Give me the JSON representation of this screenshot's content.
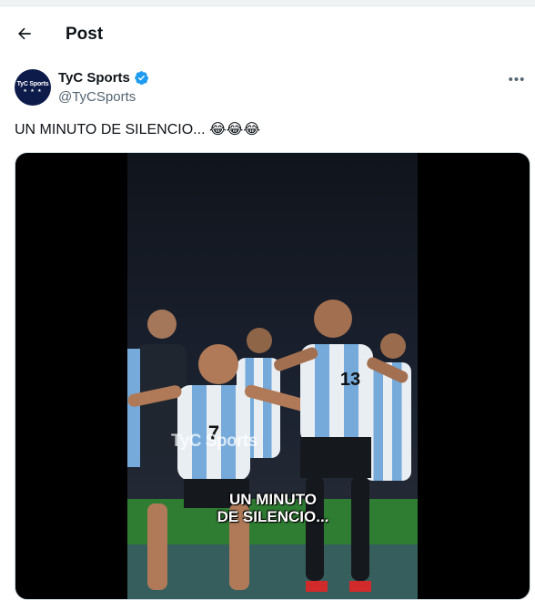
{
  "header": {
    "title": "Post"
  },
  "author": {
    "avatar_text": "TyC Sports",
    "avatar_stars": "★ ★ ★",
    "name": "TyC Sports",
    "handle": "@TyCSports",
    "verified_color": "#1d9bf0"
  },
  "more_label": "•••",
  "tweet": {
    "text": "UN MINUTO DE SILENCIO... 😂😂😂"
  },
  "media": {
    "watermark": "TyC Sports",
    "caption_line1": "UN MINUTO",
    "caption_line2": "DE SILENCIO..."
  },
  "colors": {
    "text": "#0f1419",
    "secondary": "#536471",
    "shirt_blue": "#75aadb",
    "pitch": "#2e8b2e"
  }
}
